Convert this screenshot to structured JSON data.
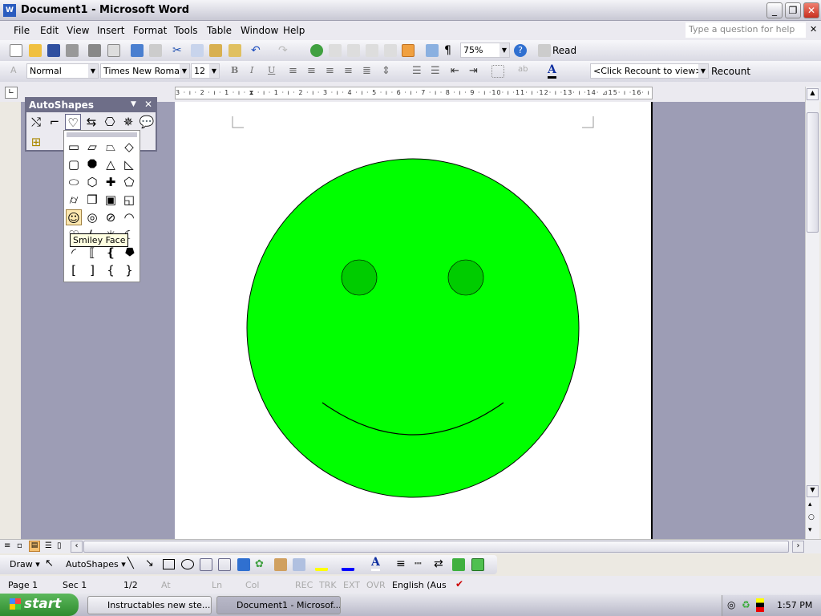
{
  "window": {
    "title": "Document1 - Microsoft Word",
    "minimize": "_",
    "restore": "❐",
    "close": "✕"
  },
  "menu": {
    "items": [
      "File",
      "Edit",
      "View",
      "Insert",
      "Format",
      "Tools",
      "Table",
      "Window",
      "Help"
    ],
    "help_placeholder": "Type a question for help",
    "close_doc": "✕"
  },
  "standard_toolbar": {
    "zoom": "75%",
    "read": "Read",
    "pilcrow": "¶"
  },
  "formatting_toolbar": {
    "style": "Normal",
    "font": "Times New Roman",
    "size": "12",
    "bold": "B",
    "italic": "I",
    "underline": "U",
    "font_color": "A",
    "wordcount": "<Click Recount to view>",
    "recount": "Recount"
  },
  "ruler": {
    "text": "3 · ı · 2 · ı · 1 · ı · ⧗ · ı · 1 · ı · 2 · ı · 3 · ı · 4 · ı · 5 · ı · 6 · ı · 7 · ı · 8 · ı · 9 · ı ·10· ı ·11· ı ·12· ı ·13· ı ·14· ⊿15· ı ·16· ı ·17· ı ·"
  },
  "autoshapes": {
    "title": "AutoShapes",
    "tooltip": "Smiley Face",
    "selected": "smiley-face"
  },
  "smiley": {
    "fill": "#00ff00",
    "eye_fill": "#00cc00",
    "outline": "#000000"
  },
  "drawing_toolbar": {
    "draw": "Draw",
    "autoshapes": "AutoShapes",
    "font_color": "A"
  },
  "status": {
    "page": "Page 1",
    "sec": "Sec 1",
    "pages": "1/2",
    "at": "At",
    "ln": "Ln",
    "col": "Col",
    "rec": "REC",
    "trk": "TRK",
    "ext": "EXT",
    "ovr": "OVR",
    "language": "English (Aus"
  },
  "taskbar": {
    "start": "start",
    "tasks": [
      "Instructables new ste...",
      "Document1 - Microsof..."
    ],
    "clock": "1:57 PM"
  }
}
